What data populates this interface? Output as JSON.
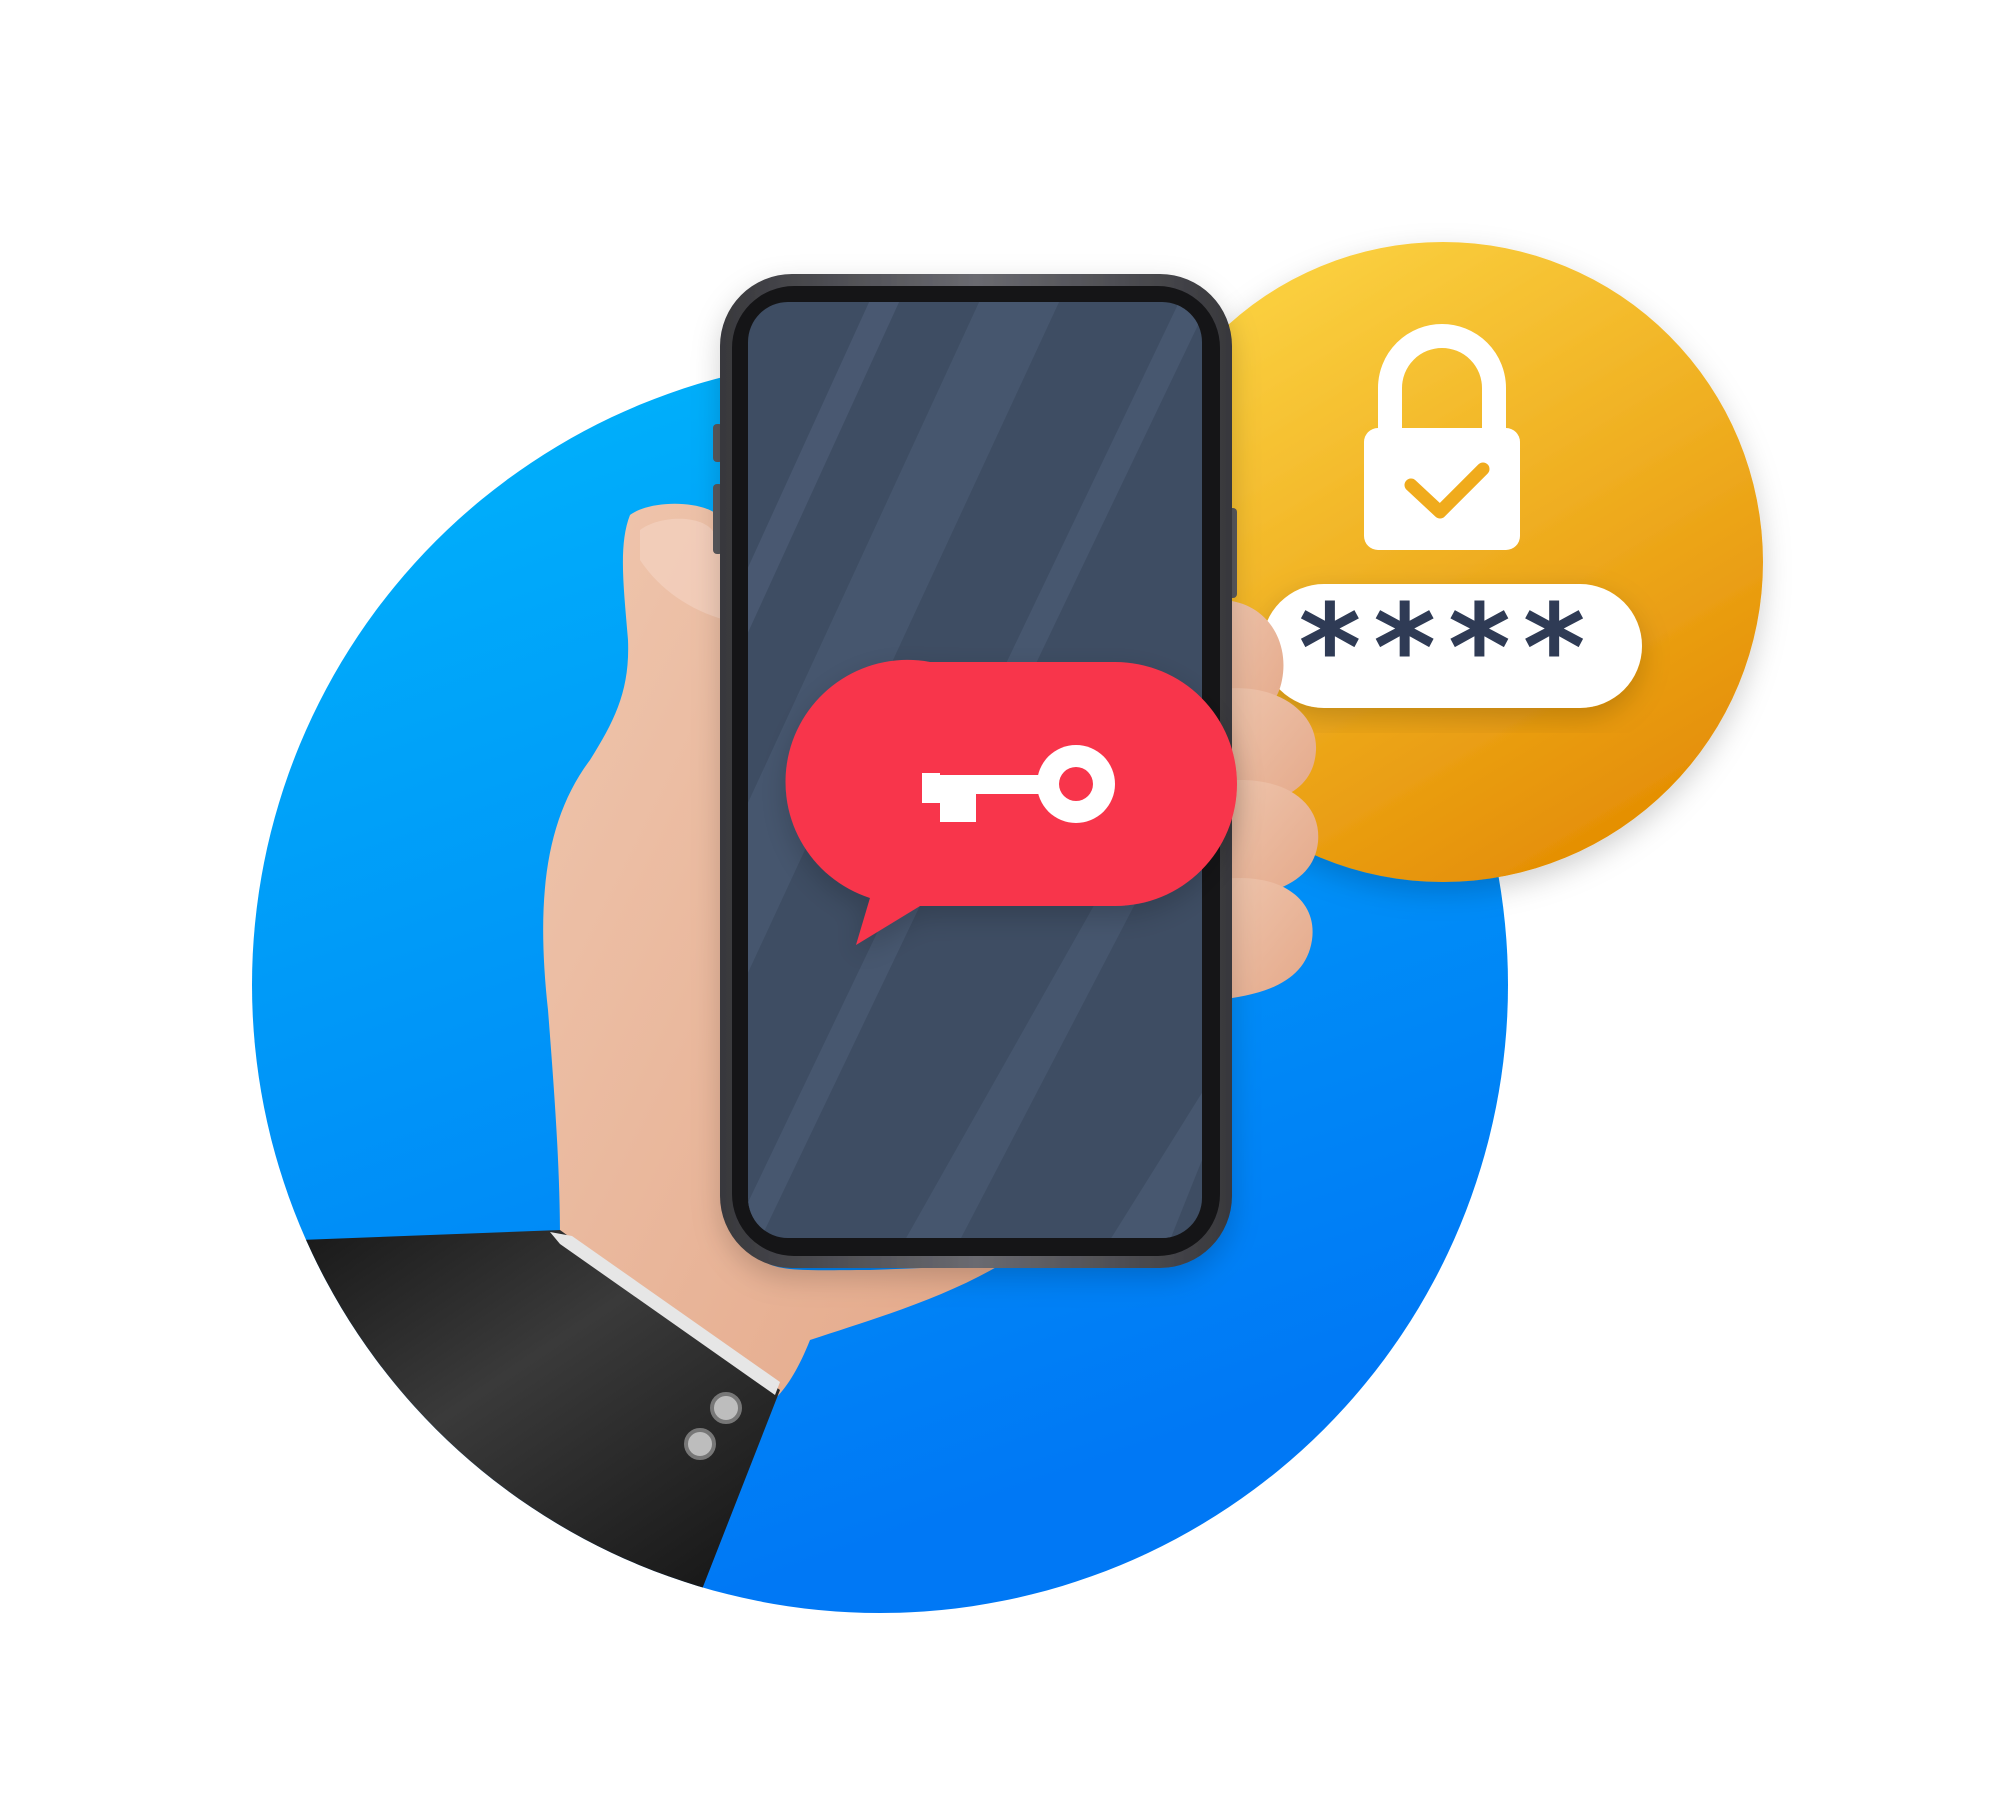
{
  "illustration": {
    "pin_field": {
      "value": "****"
    },
    "icons": {
      "phone": "smartphone-icon",
      "chat_bubble": "chat-bubble-icon",
      "key": "key-icon",
      "lock": "padlock-check-icon",
      "check": "checkmark-icon",
      "hand": "hand-icon",
      "sleeve": "suit-sleeve-icon",
      "cufflinks": "cufflink-buttons-icon"
    },
    "colors": {
      "background": "#ffffff",
      "blue_circle_top": "#00b6fb",
      "blue_circle_bottom": "#0078f5",
      "orange_circle_top": "#fcd443",
      "orange_circle_bottom": "#e38a00",
      "phone_frame": "#4b4b4f",
      "phone_screen": "#3e4d63",
      "bubble_red": "#f8354b",
      "pin_text": "#2f3b55",
      "skin": "#e9b397",
      "sleeve": "#222222"
    }
  }
}
